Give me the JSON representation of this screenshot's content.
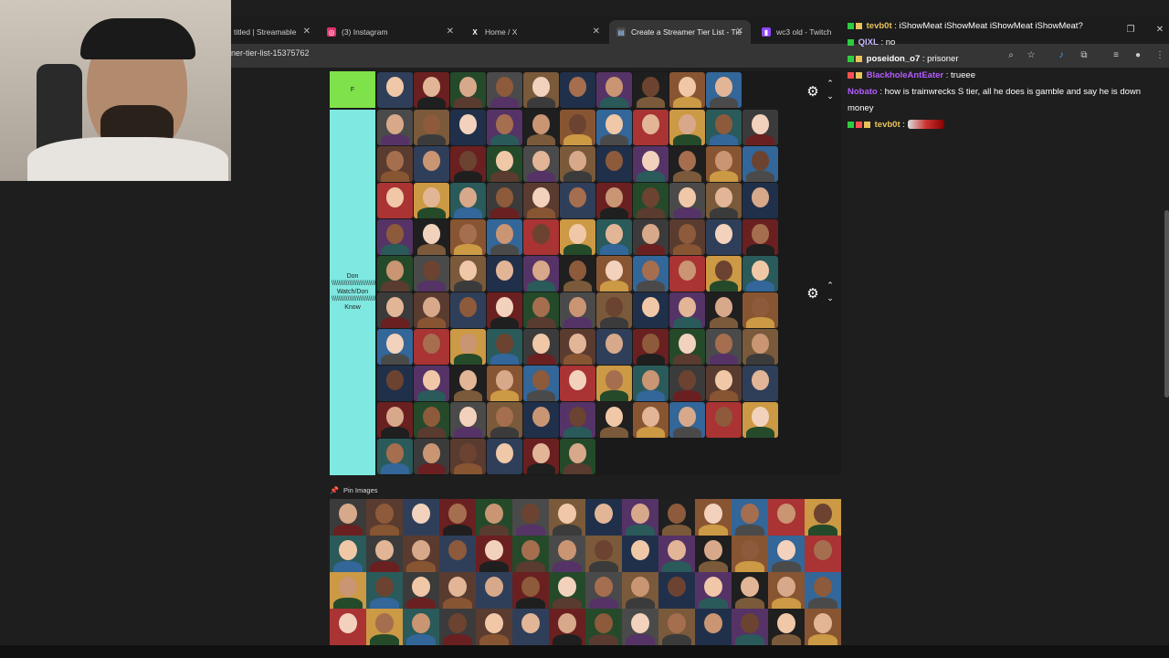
{
  "tabs": [
    {
      "label": "titled | Streamable",
      "icon": "streamable-icon",
      "color": "#1f6feb"
    },
    {
      "label": "(3) Instagram",
      "icon": "instagram-icon",
      "color": "#e1306c"
    },
    {
      "label": "Home / X",
      "icon": "x-logo-icon",
      "color": "#ffffff"
    },
    {
      "label": "Create a Streamer Tier List - Tie",
      "icon": "tiermaker-icon",
      "color": "#4aa3ff"
    },
    {
      "label": "wc3 old - Twitch",
      "icon": "twitch-icon",
      "color": "#9146ff"
    }
  ],
  "url": "ner-tier-list-15375762",
  "tiers": [
    {
      "label": "F",
      "color": "#7fe24a"
    },
    {
      "label": "Don\\\\\\\\\\\\\\\\\\\\\\\\\\\\\\\\\\\\\\\\\\\\\\\\\\\\\\\\\\\\\\\\\\\\\\\\\\\\\\\\\\\\\\\\\\\\\\\\\\\\\\\\\\\\\\\\\\\\\\\\\\\\\\\\\\\\\\\\\\\\\\\\\\\\\\\\\\\\\\\\\\\\\\\\\\\\\\\\\\\\\\\\\\\\\\\\\\\\\\\\\\\\\\\\\\\\\\\\\\\\\\\\\\\\\\\\\\\\\\\\\\\\\\\\\\\\\\\\\\\\\\\\\\\\\\\\'t Watch/Don\\\\\\\\\\\\\\\\\\\\\\\\\\\\\\\\\\\\\\\\\\\\\\\\\\\\\\\\\\\\\\\\\\\\\\\\\\\\\\\\\\\\\\\\\\\\\\\\\\\\\\\\\\\\\\\\\\\\\\\\\\\\\\\\\\\\\\\\\\\\\\\\\\\\\\\\\\\\\\\\\\\\\\\\\\\\\\\\\\\\\\\\\\\\\\\\\\\\\\\\\\\\\\\\\\\\\\\\\\\\\\\\\\\\\\\\\\\\\\\\\\\\\\\\\\\\\\\\\\\\\\\\\\'t Know",
      "color": "#7fe8e0"
    }
  ],
  "pin_label": "Pin Images",
  "chat": [
    {
      "user": "tevb0t",
      "message": "iShowMeat iShowMeat iShowMeat iShowMeat?",
      "color": "#e8c25a"
    },
    {
      "user": "QIXL",
      "message": "no",
      "color": "#c8b8ff"
    },
    {
      "user": "poseidon_o7",
      "message": "prisoner",
      "color": "#ffffff"
    },
    {
      "user": "BlackholeAntEater",
      "message": "trueee",
      "color": "#b45cff"
    },
    {
      "user": "Nobato",
      "message": "how is trainwrecks S tier, all he does is gamble and say he is down money",
      "color": "#b45cff"
    },
    {
      "user": "tevb0t",
      "message": "",
      "color": "#e8c25a"
    }
  ]
}
